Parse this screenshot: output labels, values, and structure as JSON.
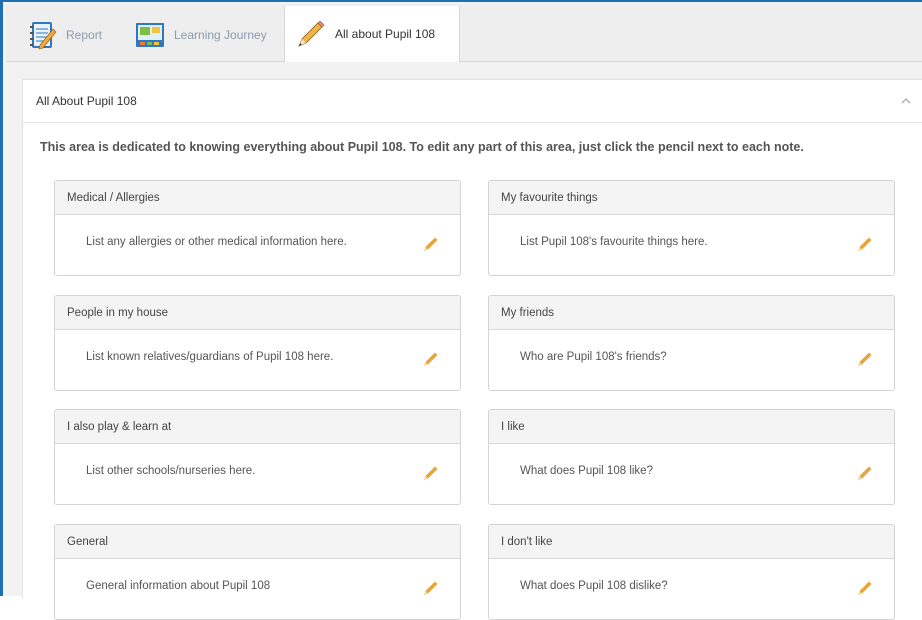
{
  "tabs": [
    {
      "label": "Report",
      "icon": "notebook-icon",
      "active": false
    },
    {
      "label": "Learning Journey",
      "icon": "picture-board-icon",
      "active": false
    },
    {
      "label": "All about Pupil 108",
      "icon": "pencil-icon",
      "active": true
    }
  ],
  "panel": {
    "title": "All About Pupil 108",
    "intro": "This area is dedicated to knowing everything about Pupil 108. To edit any part of this area, just click the pencil next to each note."
  },
  "cards": [
    {
      "title": "Medical / Allergies",
      "text": "List any allergies or other medical information here."
    },
    {
      "title": "My favourite things",
      "text": "List Pupil 108's favourite things here."
    },
    {
      "title": "People in my house",
      "text": "List known relatives/guardians of Pupil 108 here."
    },
    {
      "title": "My friends",
      "text": "Who are Pupil 108's friends?"
    },
    {
      "title": "I also play & learn at",
      "text": "List other schools/nurseries here."
    },
    {
      "title": "I like",
      "text": "What does Pupil 108 like?"
    },
    {
      "title": "General",
      "text": "General information about Pupil 108"
    },
    {
      "title": "I don't like",
      "text": "What does Pupil 108 dislike?"
    }
  ],
  "colors": {
    "accent": "#1f6fb5",
    "pencil": "#e8a43a"
  }
}
